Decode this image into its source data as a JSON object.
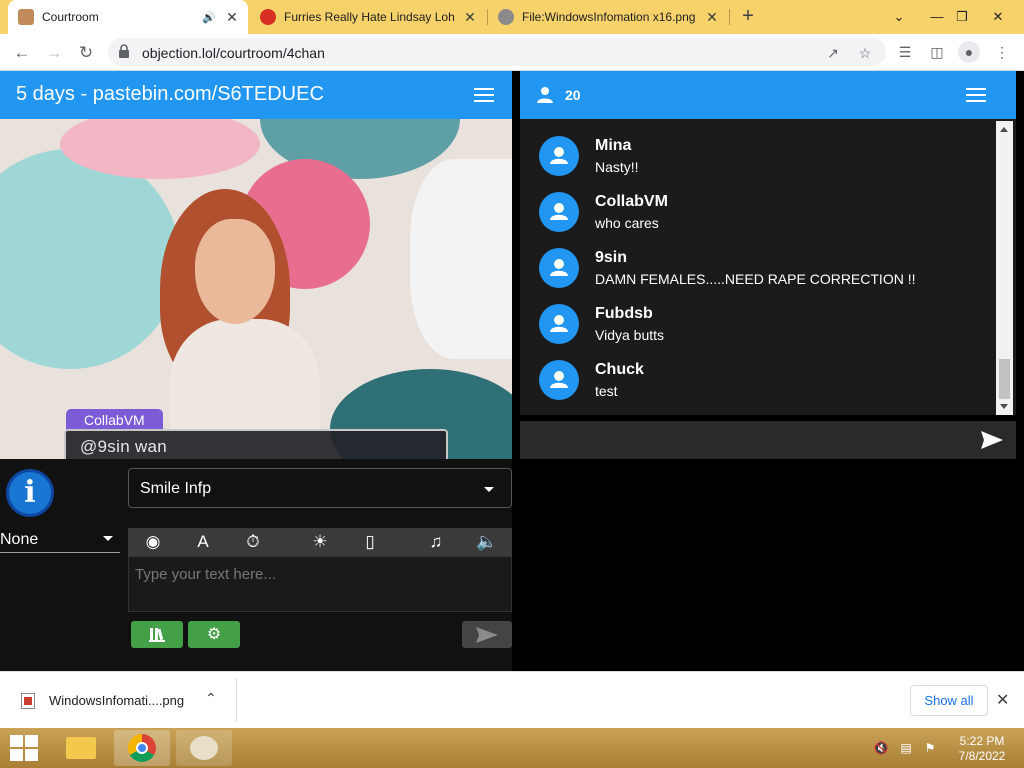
{
  "browser": {
    "tabs": [
      {
        "title": "Courtroom"
      },
      {
        "title": "Furries Really Hate Lindsay Lohan"
      },
      {
        "title": "File:WindowsInfomation x16.png"
      }
    ],
    "url": "objection.lol/courtroom/4chan"
  },
  "courtroom": {
    "title": "5 days - pastebin.com/S6TEDUEC",
    "speaker": "CollabVM",
    "dialogue": "@9sin wan",
    "character": "Smile Infp",
    "pose": "None",
    "message_placeholder": "Type your text here...",
    "info_label": "i"
  },
  "chat": {
    "user_count": "20",
    "messages": [
      {
        "user": "Mina",
        "text": "Nasty!!"
      },
      {
        "user": "CollabVM",
        "text": "who cares"
      },
      {
        "user": "9sin",
        "text": "DAMN FEMALES.....NEED RAPE CORRECTION !!"
      },
      {
        "user": "Fubdsb",
        "text": "Vidya butts"
      },
      {
        "user": "Chuck",
        "text": "test"
      }
    ]
  },
  "downloads": {
    "file": "WindowsInfomati....png",
    "show_all": "Show all"
  },
  "taskbar": {
    "time": "5:22 PM",
    "date": "7/8/2022"
  },
  "colors": {
    "accent": "#2196f3",
    "green": "#43a047",
    "nameplate": "#7b5cd6",
    "tabstrip": "#f7d26a"
  }
}
